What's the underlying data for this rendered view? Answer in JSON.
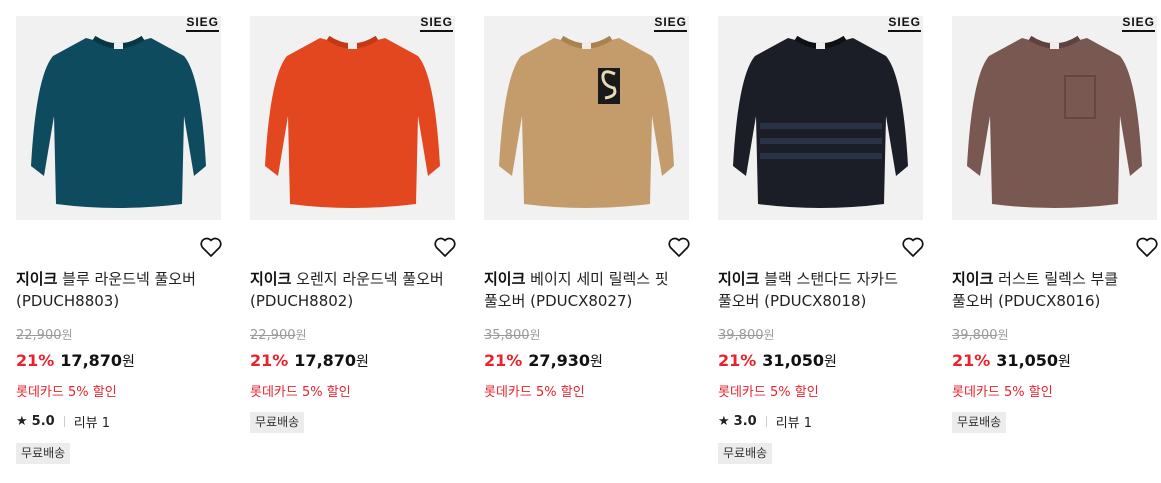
{
  "products": [
    {
      "logo": "SIEG",
      "brand": "지이크",
      "title": " 블루 라운드넥 풀오버 (PDUCH8803)",
      "original_price": "22,900",
      "currency": "원",
      "discount": "21%",
      "sale_price": "17,870",
      "card_promo": "롯데카드 5% 할인",
      "rating": "5.0",
      "reviews": "리뷰 1",
      "badge": "무료배송",
      "color": "#0f4b5e"
    },
    {
      "logo": "SIEG",
      "brand": "지이크",
      "title": " 오렌지 라운드넥 풀오버 (PDUCH8802)",
      "original_price": "22,900",
      "currency": "원",
      "discount": "21%",
      "sale_price": "17,870",
      "card_promo": "롯데카드 5% 할인",
      "badge": "무료배송",
      "color": "#e2471f"
    },
    {
      "logo": "SIEG",
      "brand": "지이크",
      "title": " 베이지 세미 릴렉스 핏 풀오버 (PDUCX8027)",
      "original_price": "35,800",
      "currency": "원",
      "discount": "21%",
      "sale_price": "27,930",
      "card_promo": "롯데카드 5% 할인",
      "color": "#c49c6c"
    },
    {
      "logo": "SIEG",
      "brand": "지이크",
      "title": " 블랙 스탠다드 자카드 풀오버 (PDUCX8018)",
      "original_price": "39,800",
      "currency": "원",
      "discount": "21%",
      "sale_price": "31,050",
      "card_promo": "롯데카드 5% 할인",
      "rating": "3.0",
      "reviews": "리뷰 1",
      "badge": "무료배송",
      "color": "#1b1e26"
    },
    {
      "logo": "SIEG",
      "brand": "지이크",
      "title": " 러스트 릴렉스 부클 풀오버 (PDUCX8016)",
      "original_price": "39,800",
      "currency": "원",
      "discount": "21%",
      "sale_price": "31,050",
      "card_promo": "롯데카드 5% 할인",
      "badge": "무료배송",
      "color": "#7a5852"
    }
  ],
  "icons": {
    "wishlist": "heart-outline-icon",
    "rating": "star-icon"
  },
  "accent_color": "#e8232e"
}
